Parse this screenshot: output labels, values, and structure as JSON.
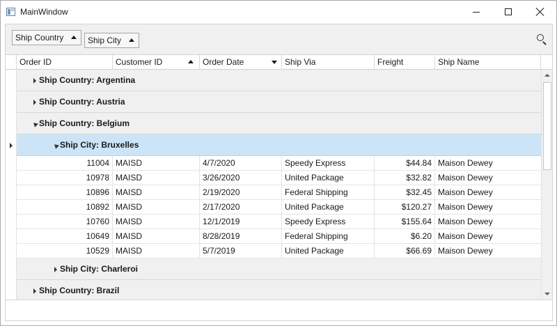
{
  "window": {
    "title": "MainWindow"
  },
  "group_panel": {
    "chips": [
      {
        "label": "Ship Country",
        "sort": "ascending"
      },
      {
        "label": "Ship City",
        "sort": "ascending"
      }
    ],
    "search_icon": "search-icon"
  },
  "grid": {
    "columns": [
      {
        "label": "Order ID"
      },
      {
        "label": "Customer ID",
        "sort": "ascending"
      },
      {
        "label": "Order Date",
        "filter": "descending"
      },
      {
        "label": "Ship Via"
      },
      {
        "label": "Freight"
      },
      {
        "label": "Ship Name"
      }
    ],
    "groups": {
      "argentina": "Ship Country: Argentina",
      "austria": "Ship Country: Austria",
      "belgium": "Ship Country: Belgium",
      "bruxelles": "Ship City: Bruxelles",
      "charleroi": "Ship City: Charleroi",
      "brazil": "Ship Country: Brazil"
    },
    "rows": [
      {
        "order_id": "11004",
        "customer_id": "MAISD",
        "order_date": "4/7/2020",
        "ship_via": "Speedy Express",
        "freight": "$44.84",
        "ship_name": "Maison Dewey"
      },
      {
        "order_id": "10978",
        "customer_id": "MAISD",
        "order_date": "3/26/2020",
        "ship_via": "United Package",
        "freight": "$32.82",
        "ship_name": "Maison Dewey"
      },
      {
        "order_id": "10896",
        "customer_id": "MAISD",
        "order_date": "2/19/2020",
        "ship_via": "Federal Shipping",
        "freight": "$32.45",
        "ship_name": "Maison Dewey"
      },
      {
        "order_id": "10892",
        "customer_id": "MAISD",
        "order_date": "2/17/2020",
        "ship_via": "United Package",
        "freight": "$120.27",
        "ship_name": "Maison Dewey"
      },
      {
        "order_id": "10760",
        "customer_id": "MAISD",
        "order_date": "12/1/2019",
        "ship_via": "Speedy Express",
        "freight": "$155.64",
        "ship_name": "Maison Dewey"
      },
      {
        "order_id": "10649",
        "customer_id": "MAISD",
        "order_date": "8/28/2019",
        "ship_via": "Federal Shipping",
        "freight": "$6.20",
        "ship_name": "Maison Dewey"
      },
      {
        "order_id": "10529",
        "customer_id": "MAISD",
        "order_date": "5/7/2019",
        "ship_via": "United Package",
        "freight": "$66.69",
        "ship_name": "Maison Dewey"
      }
    ]
  },
  "colors": {
    "selected_group": "#cce4f7",
    "group_background": "#f0f0f0"
  }
}
